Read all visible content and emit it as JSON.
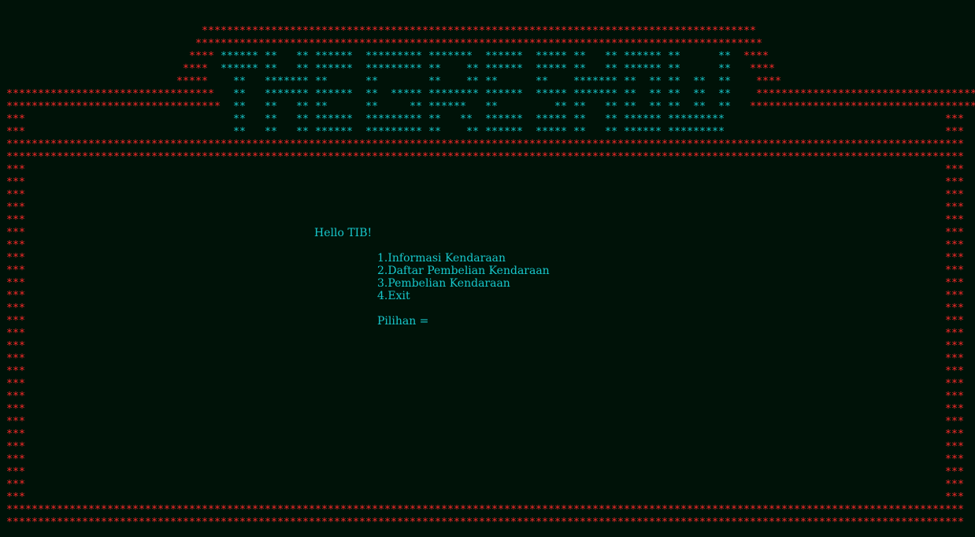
{
  "colors": {
    "background": "#001208",
    "border": "#ff2b2b",
    "text": "#17c8cc"
  },
  "banner": {
    "rows": [
      {
        "segments": [
          {
            "text": "****************************************************************************************",
            "color": "red"
          }
        ]
      },
      {
        "segments": [
          {
            "text": "******************************************************************************************",
            "color": "red"
          }
        ]
      },
      {
        "segments": [
          {
            "text": "**** ",
            "color": "red"
          },
          {
            "text": "****** **   ** ******  ********* *******  ******  ***** **   ** ****** **      **",
            "color": "cyan"
          },
          {
            "text": "  ****",
            "color": "red"
          }
        ]
      },
      {
        "segments": [
          {
            "text": "****  ",
            "color": "red"
          },
          {
            "text": "****** **   ** ******  ********* **    ** ******  ***** **   ** ****** **      **",
            "color": "cyan"
          },
          {
            "text": "   ****",
            "color": "red"
          }
        ]
      },
      {
        "segments": [
          {
            "text": "*****    ",
            "color": "red"
          },
          {
            "text": "**   ******* **      **        **    ** **      **    ******* **  ** **  **  **",
            "color": "cyan"
          },
          {
            "text": "    ****",
            "color": "red"
          }
        ]
      },
      {
        "segments": [
          {
            "text": "*********************************   ",
            "color": "red"
          },
          {
            "text": "**   ******* ******  **  ***** ******** ******  ***** ******* **  ** **  **  **",
            "color": "cyan"
          },
          {
            "text": "    ***********************************",
            "color": "red"
          }
        ]
      },
      {
        "segments": [
          {
            "text": "**********************************  ",
            "color": "red"
          },
          {
            "text": "**   **   ** **      **     ** ******   **         ** **   ** **  ** **  **  **",
            "color": "cyan"
          },
          {
            "text": "   ************************************",
            "color": "red"
          }
        ]
      },
      {
        "segments": [
          {
            "text": "***                                 ",
            "color": "red"
          },
          {
            "text": "**   **   ** ******  ********* **   **  ******  ***** **   ** ****** *********",
            "color": "cyan"
          }
        ]
      },
      {
        "segments": [
          {
            "text": "***                                 ",
            "color": "red"
          },
          {
            "text": "**   **   ** ******  ********* **    ** ******  ***** **   ** ****** *********",
            "color": "cyan"
          }
        ]
      }
    ]
  },
  "greeting": "Hello TIB!",
  "menu": {
    "items": [
      "1.Informasi Kendaraan",
      "2.Daftar Pembelian Kendaraan",
      "3.Pembelian Kendaraan",
      "4.Exit"
    ],
    "prompt": "Pilihan ="
  }
}
